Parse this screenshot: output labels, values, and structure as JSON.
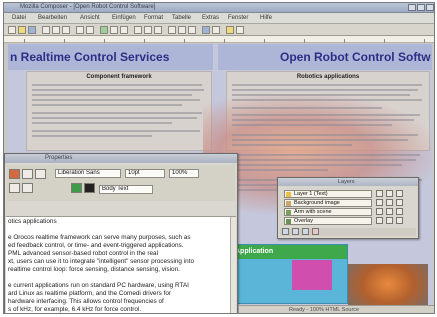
{
  "window": {
    "title": "Mozilla Composer - [Open Robot Control Software]"
  },
  "menu": [
    "Datei",
    "Bearbeiten",
    "Ansicht",
    "Einfügen",
    "Format",
    "Tabelle",
    "Extras",
    "Fenster",
    "Hilfe"
  ],
  "page": {
    "left_heading": "n Realtime Control Services",
    "right_heading": "Open Robot Control Softw",
    "left_col_heading": "Component framework",
    "right_col_heading": "Robotics applications",
    "application_block": "Application"
  },
  "inspector": {
    "title": "Properties",
    "font_field": "Liberation Sans",
    "size_field": "10pt",
    "zoom_field": "100%",
    "style_field": "Body Text",
    "text_lines": [
      "otics applications",
      "",
      "e Orocos realtime framework can serve many purposes, such as",
      "ed feedback control, or time- and event-triggered applications.",
      "PML advanced sensor-based robot control in the real",
      "xt, users can use it to integrate \"intelligent\" sensor processing into",
      "realtime control loop: force sensing, distance sensing, vision.",
      "",
      "e current applications run on standard PC hardware, using RTAI",
      "ard Linux as realtime platform, and the Comedi drivers for",
      "hardware interfacing. This allows control frequencies of",
      "s of kHz, for example, 6.4 kHz for force control."
    ]
  },
  "layers": {
    "title": "Layers",
    "rows": [
      {
        "label": "Layer 1 (Text)",
        "color": "#e8c04a"
      },
      {
        "label": "Background image",
        "color": "#c9a86a"
      },
      {
        "label": "Arm with scene",
        "color": "#7aa060"
      },
      {
        "label": "Overlay",
        "color": "#6a8f5a"
      }
    ]
  },
  "status": {
    "text": "Ready - 100%  HTML Source"
  },
  "colors": {
    "heading": "#2c2f86",
    "banner": "#aeb6d8",
    "application_bar": "#3fa84a",
    "application_bg": "#5bb5d8"
  }
}
